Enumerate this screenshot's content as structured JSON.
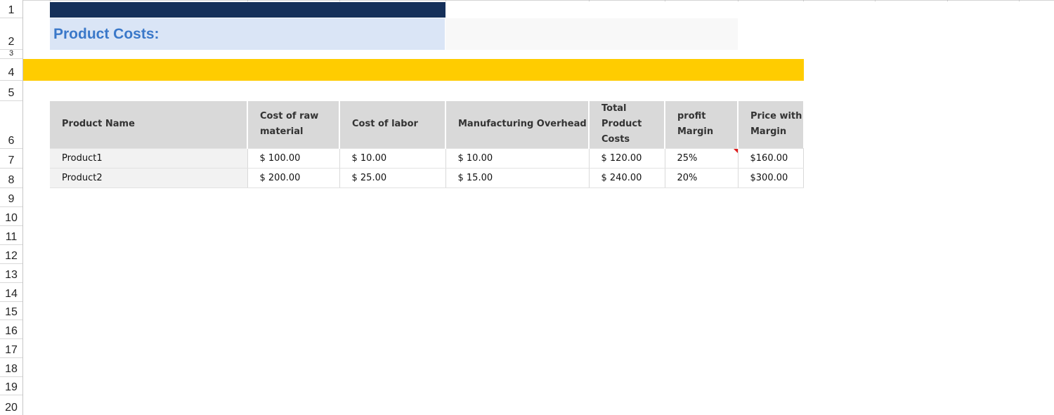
{
  "row_headers": [
    "1",
    "2",
    "3",
    "4",
    "5",
    "6",
    "7",
    "8",
    "9",
    "10",
    "11",
    "12",
    "13",
    "14",
    "15",
    "16",
    "17",
    "18",
    "19",
    "20"
  ],
  "title": "Product Costs:",
  "colors": {
    "navy": "#15305a",
    "title_fill": "#dae5f6",
    "title_text": "#3a78c9",
    "yellow": "#ffcc00",
    "header_fill": "#d9d9d9",
    "comment_indicator": "#e01b1b"
  },
  "table": {
    "headers": [
      "Product Name",
      "Cost of raw material",
      "Cost of labor",
      "Manufacturing Overhead",
      "Total Product Costs",
      "profit Margin",
      "Price with Margin"
    ],
    "rows": [
      [
        "Product1",
        "$ 100.00",
        "$ 10.00",
        "$ 10.00",
        "$ 120.00",
        "25%",
        "$160.00"
      ],
      [
        "Product2",
        "$ 200.00",
        "$ 25.00",
        "$ 15.00",
        "$ 240.00",
        "20%",
        "$300.00"
      ]
    ]
  }
}
